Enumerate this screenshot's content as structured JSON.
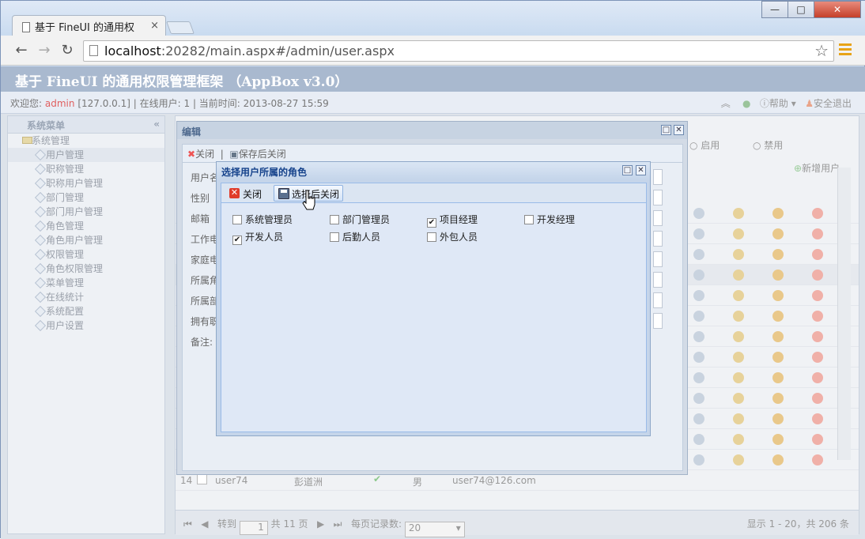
{
  "browser": {
    "tab_title": "基于 FineUI 的通用权",
    "tab_close": "×",
    "url_host": "localhost",
    "url_rest": ":20282/main.aspx#/admin/user.aspx",
    "nav": {
      "back": "←",
      "forward": "→",
      "reload": "↻"
    },
    "star": "☆",
    "window_buttons": {
      "minimize": "—",
      "maximize": "□",
      "close": "✕"
    }
  },
  "app": {
    "title": "基于 FineUI 的通用权限管理框架 （AppBox v3.0）",
    "info": {
      "welcome": "欢迎您:",
      "user": "admin",
      "ip": "[127.0.0.1]",
      "online_label": "在线用户:",
      "online_count": "1",
      "time_label": "当前时间:",
      "time": "2013-08-27 15:59",
      "help": "帮助",
      "logout": "安全退出"
    },
    "sidebar": {
      "title": "系统菜单",
      "collapse": "«",
      "root": "系统管理",
      "items": [
        "用户管理",
        "职称管理",
        "职称用户管理",
        "部门管理",
        "部门用户管理",
        "角色管理",
        "角色用户管理",
        "权限管理",
        "角色权限管理",
        "菜单管理",
        "在线统计",
        "系统配置",
        "用户设置"
      ]
    },
    "grid": {
      "filter_enabled": "启用",
      "filter_disabled": "禁用",
      "add_user": "新增用户",
      "row14": {
        "num": "14",
        "user": "user74",
        "name": "彭道洲",
        "gender": "男",
        "email": "user74@126.com"
      },
      "pager": {
        "goto": "转到",
        "page": "1",
        "total_pages": "共 11 页",
        "per_page_label": "每页记录数:",
        "per_page": "20",
        "summary": "显示 1 - 20，共 206 条"
      }
    }
  },
  "edit_window": {
    "title": "编辑",
    "close": "关闭",
    "save_close": "保存后关闭",
    "fields": [
      "用户名",
      "性别",
      "邮箱",
      "工作电",
      "家庭电",
      "所属角",
      "所属部",
      "拥有职",
      "备注:"
    ]
  },
  "role_window": {
    "title": "选择用户所属的角色",
    "close": "关闭",
    "select_close": "选择后关闭",
    "roles": [
      {
        "label": "系统管理员",
        "checked": false
      },
      {
        "label": "部门管理员",
        "checked": false
      },
      {
        "label": "项目经理",
        "checked": true
      },
      {
        "label": "开发经理",
        "checked": false
      },
      {
        "label": "开发人员",
        "checked": true
      },
      {
        "label": "后勤人员",
        "checked": false
      },
      {
        "label": "外包人员",
        "checked": false
      }
    ]
  }
}
